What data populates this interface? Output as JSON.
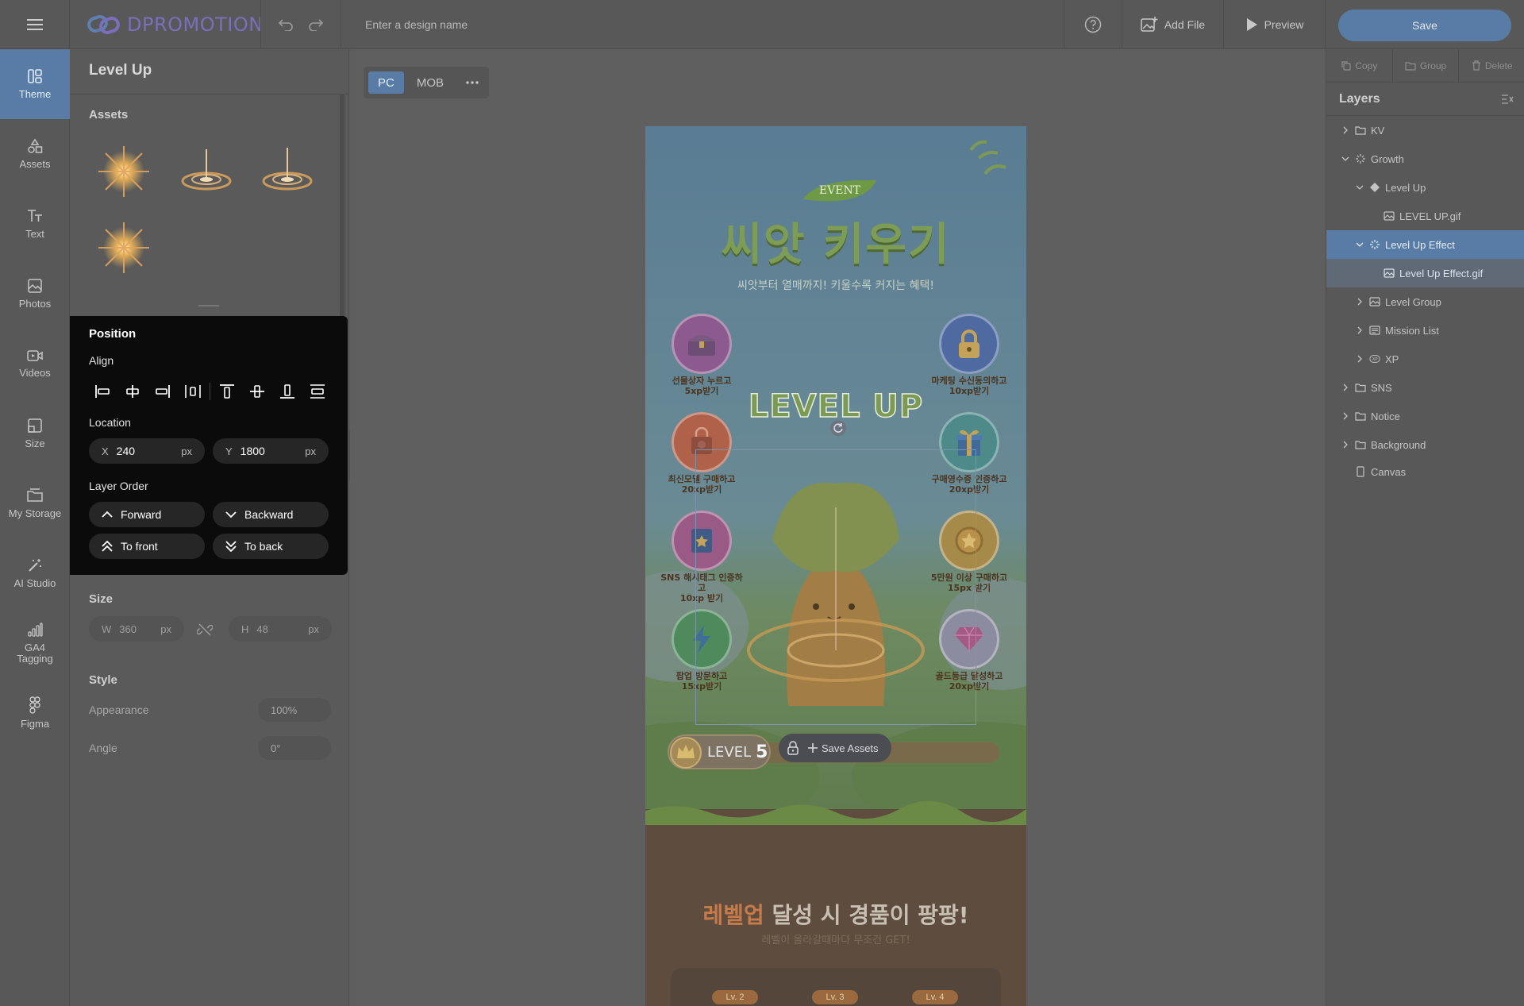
{
  "topbar": {
    "logo_text": "DPROMOTION",
    "design_name_placeholder": "Enter a design name",
    "add_file_label": "Add File",
    "preview_label": "Preview",
    "save_label": "Save"
  },
  "rail": {
    "items": [
      {
        "label": "Theme",
        "icon": "theme-icon"
      },
      {
        "label": "Assets",
        "icon": "shapes-icon"
      },
      {
        "label": "Text",
        "icon": "text-icon"
      },
      {
        "label": "Photos",
        "icon": "photo-icon"
      },
      {
        "label": "Videos",
        "icon": "video-icon"
      },
      {
        "label": "Size",
        "icon": "size-icon"
      },
      {
        "label": "My Storage",
        "icon": "folder-icon"
      },
      {
        "label": "AI Studio",
        "icon": "magic-wand-icon"
      },
      {
        "label": "GA4\nTagging",
        "icon": "bar-chart-icon"
      },
      {
        "label": "Figma",
        "icon": "figma-icon"
      }
    ]
  },
  "panel": {
    "title": "Level Up",
    "assets_heading": "Assets",
    "size_heading": "Size",
    "width_label": "W",
    "width_value": "360",
    "height_label": "H",
    "height_value": "48",
    "unit": "px",
    "style_heading": "Style",
    "appearance_label": "Appearance",
    "appearance_value": "100%",
    "angle_label": "Angle",
    "angle_value": "0°"
  },
  "position": {
    "heading": "Position",
    "align_label": "Align",
    "location_label": "Location",
    "x_label": "X",
    "x_value": "240",
    "y_label": "Y",
    "y_value": "1800",
    "unit": "px",
    "layer_order_label": "Layer Order",
    "forward": "Forward",
    "backward": "Backward",
    "to_front": "To front",
    "to_back": "To back"
  },
  "canvas": {
    "device_pc": "PC",
    "device_mob": "MOB",
    "event_badge": "EVENT",
    "headline": "씨앗 키우기",
    "subtitle": "씨앗부터 열매까지! 키울수록 커지는 혜택!",
    "level_up_text": "LEVEL UP",
    "missions": [
      {
        "label": "선물상자 누르고\n5xp받기"
      },
      {
        "label": "마케팅 수신동의하고\n10xp받기"
      },
      {
        "label": "최신모델 구매하고\n20xp받기"
      },
      {
        "label": "구매영수증 인증하고\n20xp받기"
      },
      {
        "label": "SNS 해시태그 인증하고\n10xp 받기"
      },
      {
        "label": "5만원 이상 구매하고\n15px 받기"
      },
      {
        "label": "팝업 방문하고\n15xp받기"
      },
      {
        "label": "골드등급 달성하고\n20xp받기"
      }
    ],
    "level_label": "LEVEL",
    "level_number": "5",
    "save_assets": "Save Assets",
    "bottom_headline_accent": "레벨업",
    "bottom_headline_rest": " 달성 시 경품이 팡팡!",
    "bottom_sub": "레벨이 올라갈때마다 무조건 GET!",
    "level_tabs": [
      "Lv. 2",
      "Lv. 3",
      "Lv. 4"
    ]
  },
  "right": {
    "copy": "Copy",
    "group": "Group",
    "delete": "Delete",
    "layers_heading": "Layers",
    "layers": [
      {
        "label": "KV",
        "type": "folder",
        "depth": 0,
        "chevron": "right"
      },
      {
        "label": "Growth",
        "type": "effect",
        "depth": 0,
        "chevron": "down"
      },
      {
        "label": "Level Up",
        "type": "shape",
        "depth": 1,
        "chevron": "down"
      },
      {
        "label": "LEVEL UP.gif",
        "type": "image",
        "depth": 2,
        "chevron": "none"
      },
      {
        "label": "Level Up Effect",
        "type": "effect",
        "depth": 1,
        "chevron": "down",
        "state": "selected"
      },
      {
        "label": "Level Up Effect.gif",
        "type": "image",
        "depth": 2,
        "chevron": "none",
        "state": "child"
      },
      {
        "label": "Level Group",
        "type": "image",
        "depth": 1,
        "chevron": "right"
      },
      {
        "label": "Mission List",
        "type": "list",
        "depth": 1,
        "chevron": "right"
      },
      {
        "label": "XP",
        "type": "xp",
        "depth": 1,
        "chevron": "right"
      },
      {
        "label": "SNS",
        "type": "folder",
        "depth": 0,
        "chevron": "right"
      },
      {
        "label": "Notice",
        "type": "folder",
        "depth": 0,
        "chevron": "right"
      },
      {
        "label": "Background",
        "type": "folder",
        "depth": 0,
        "chevron": "right"
      },
      {
        "label": "Canvas",
        "type": "canvas",
        "depth": 0,
        "chevron": "none"
      }
    ]
  },
  "colors": {
    "accent": "#587ca6",
    "popup_bg": "#0b0b0b",
    "chrome_bg": "#585858"
  }
}
